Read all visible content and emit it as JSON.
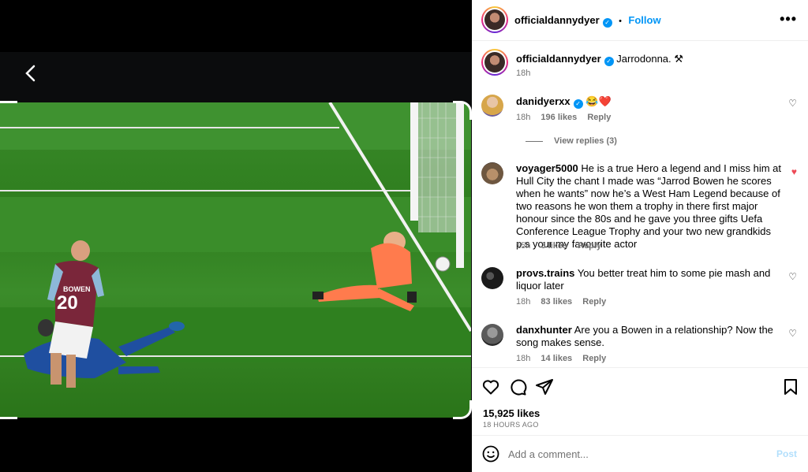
{
  "viewer": {
    "back_icon": "chevron-left-icon"
  },
  "header": {
    "username": "officialdannydyer",
    "separator": "•",
    "follow_label": "Follow",
    "more_icon": "more-horizontal-icon"
  },
  "caption": {
    "username": "officialdannydyer",
    "text": "Jarrodonna. ⚒",
    "time": "18h"
  },
  "comments": [
    {
      "username": "danidyerxx",
      "text": "😂❤️",
      "time": "18h",
      "likes": "196 likes",
      "reply": "Reply",
      "liked": false,
      "view_replies": "View replies (3)"
    },
    {
      "username": "voyager5000",
      "text": "He is a true Hero a legend and I miss him at Hull City the chant I made was “Jarrod Bowen he scores when he wants” now he’s a West Ham Legend because of two reasons he won them a trophy in there first major honour since the 80s and he gave you three gifts Uefa Conference League Trophy and your two new grandkids p.s your my favourite actor",
      "time": "15h",
      "likes": "3 likes",
      "reply": "Reply",
      "liked": true
    },
    {
      "username": "provs.trains",
      "text": "You better treat him to some pie mash and liquor later",
      "time": "18h",
      "likes": "83 likes",
      "reply": "Reply",
      "liked": false
    },
    {
      "username": "danxhunter",
      "text": "Are you a Bowen in a relationship? Now the song makes sense.",
      "time": "18h",
      "likes": "14 likes",
      "reply": "Reply",
      "liked": false
    }
  ],
  "actions": {
    "like_icon": "heart-icon",
    "comment_icon": "comment-icon",
    "share_icon": "send-icon",
    "save_icon": "bookmark-icon"
  },
  "likes_count": "15,925 likes",
  "posted_ago": "18 HOURS AGO",
  "add_comment": {
    "placeholder": "Add a comment...",
    "post_label": "Post",
    "emoji_icon": "smiley-icon"
  },
  "photo": {
    "shirt_number": "20",
    "shirt_name": "BOWEN"
  },
  "colors": {
    "accent": "#0095f6",
    "liked": "#ed4956",
    "pitch": "#2e7d1e"
  }
}
